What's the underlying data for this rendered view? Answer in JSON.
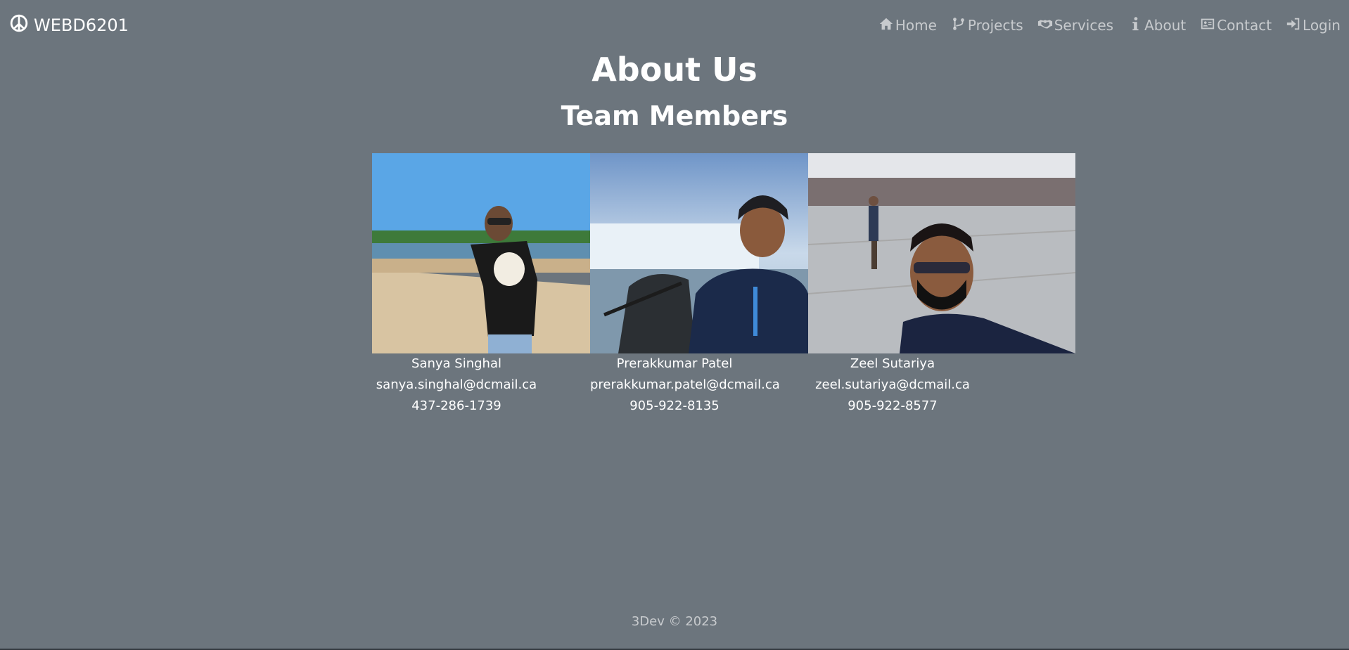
{
  "brand": {
    "icon": "peace-icon",
    "label": "WEBD6201"
  },
  "nav": [
    {
      "label": "Home",
      "icon": "house-icon"
    },
    {
      "label": "Projects",
      "icon": "code-branch-icon"
    },
    {
      "label": "Services",
      "icon": "handshake-icon"
    },
    {
      "label": "About",
      "icon": "info-icon"
    },
    {
      "label": "Contact",
      "icon": "contact-card-icon"
    },
    {
      "label": "Login",
      "icon": "sign-in-icon"
    }
  ],
  "page": {
    "title": "About Us",
    "subtitle": "Team Members"
  },
  "members": [
    {
      "name": "Sanya Singhal",
      "email": "sanya.singhal@dcmail.ca",
      "phone": "437-286-1739"
    },
    {
      "name": "Prerakkumar Patel",
      "email": "prerakkumar.patel@dcmail.ca",
      "phone": "905-922-8135"
    },
    {
      "name": "Zeel Sutariya",
      "email": "zeel.sutariya@dcmail.ca",
      "phone": "905-922-8577"
    }
  ],
  "footer": {
    "text": "3Dev © 2023"
  }
}
